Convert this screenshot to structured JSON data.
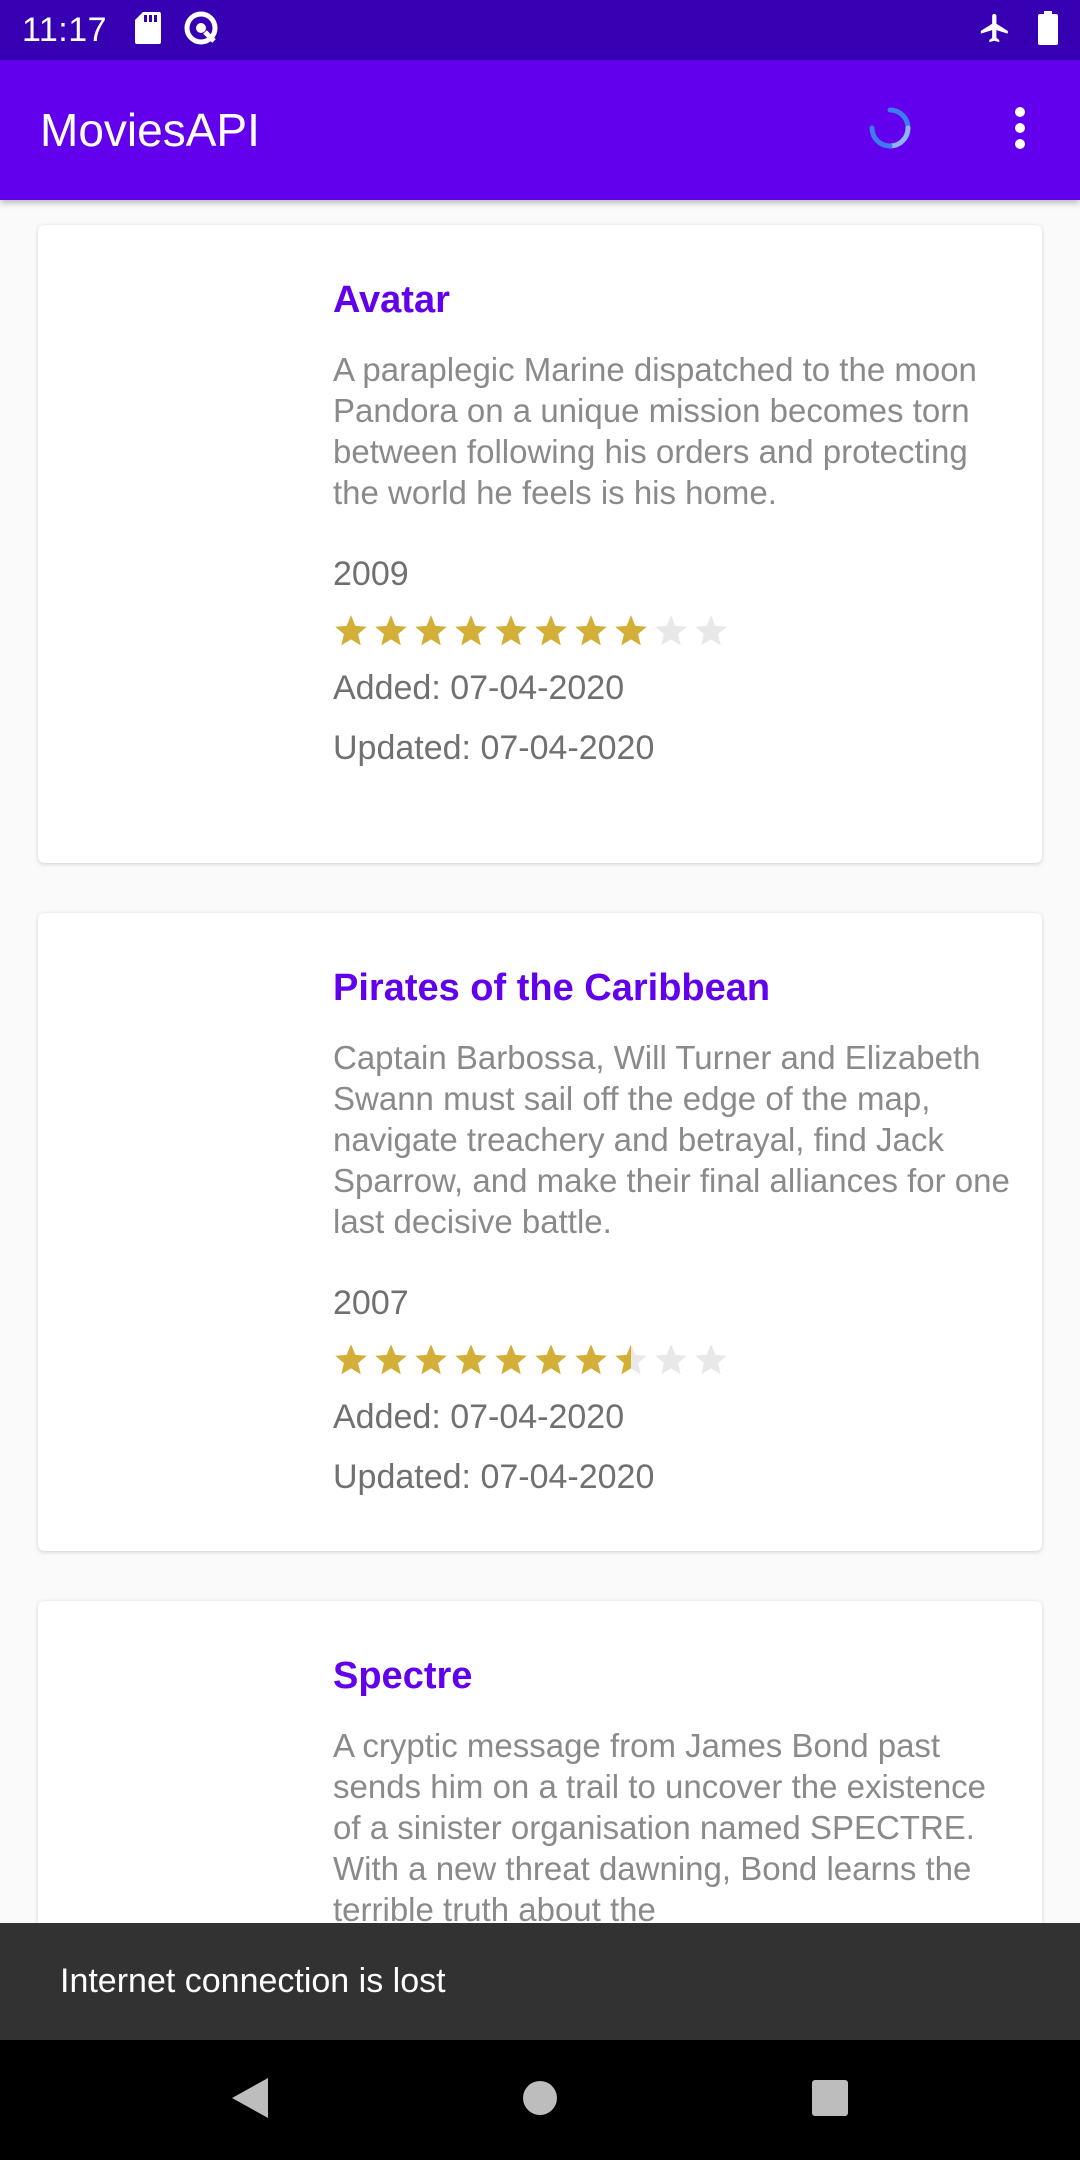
{
  "status_bar": {
    "time": "11:17",
    "icons_left": [
      "sd-card-icon",
      "data-saver-icon"
    ],
    "icons_right": [
      "airplane-mode-icon",
      "battery-icon"
    ]
  },
  "app_bar": {
    "title": "MoviesAPI",
    "actions": [
      "refresh-progress-icon",
      "more-vert-icon"
    ]
  },
  "movies": [
    {
      "title": "Avatar",
      "overview": "A paraplegic Marine dispatched to the moon Pandora on a unique mission becomes torn between following his orders and protecting the world he feels is his home.",
      "year": "2009",
      "rating": 8,
      "rating_max": 10,
      "added": "Added: 07-04-2020",
      "updated": "Updated: 07-04-2020"
    },
    {
      "title": "Pirates of the Caribbean",
      "overview": "Captain Barbossa, Will Turner and Elizabeth Swann must sail off the edge of the map, navigate treachery and betrayal, find Jack Sparrow, and make their final alliances for one last decisive battle.",
      "year": "2007",
      "rating": 7.5,
      "rating_max": 10,
      "added": "Added: 07-04-2020",
      "updated": "Updated: 07-04-2020"
    },
    {
      "title": "Spectre",
      "overview": "A cryptic message from James Bond past sends him on a trail to uncover the existence of a sinister organisation named SPECTRE. With a new threat dawning, Bond learns the terrible truth about the",
      "year": "",
      "rating": null,
      "rating_max": 10,
      "added": "",
      "updated": ""
    }
  ],
  "snackbar": {
    "message": "Internet connection is lost"
  },
  "nav_bar": {
    "buttons": [
      "back-icon",
      "home-icon",
      "recents-icon"
    ]
  },
  "colors": {
    "status_bar": "#3700b3",
    "app_bar": "#6200ee",
    "title_text": "#6200ee",
    "star_filled": "#d4af37",
    "star_empty": "#e8e8e8",
    "snackbar": "#323232"
  }
}
